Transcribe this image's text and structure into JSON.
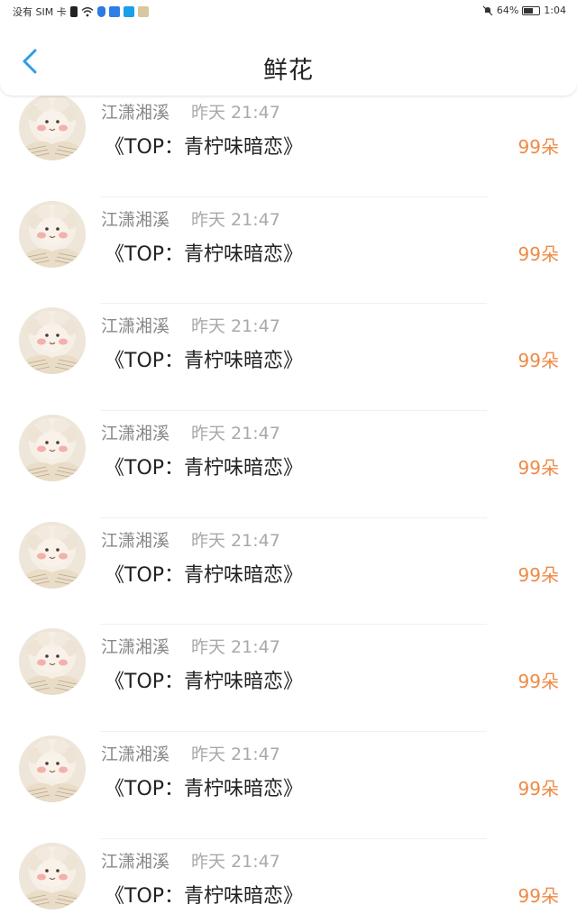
{
  "status_bar": {
    "carrier": "没有 SIM 卡",
    "battery_percent": "64%",
    "battery_level": 0.64,
    "time": "1:04"
  },
  "header": {
    "title": "鲜花",
    "back_icon": "chevron-left-icon"
  },
  "colors": {
    "accent_blue": "#2f9be8",
    "count_orange": "#ee8a45",
    "name_gray": "#888888",
    "time_gray": "#a9a9a9"
  },
  "items": [
    {
      "user": "江潇湘溪",
      "time": "昨天 21:47",
      "gift": "《TOP：青柠味暗恋》",
      "count": "99朵"
    },
    {
      "user": "江潇湘溪",
      "time": "昨天 21:47",
      "gift": "《TOP：青柠味暗恋》",
      "count": "99朵"
    },
    {
      "user": "江潇湘溪",
      "time": "昨天 21:47",
      "gift": "《TOP：青柠味暗恋》",
      "count": "99朵"
    },
    {
      "user": "江潇湘溪",
      "time": "昨天 21:47",
      "gift": "《TOP：青柠味暗恋》",
      "count": "99朵"
    },
    {
      "user": "江潇湘溪",
      "time": "昨天 21:47",
      "gift": "《TOP：青柠味暗恋》",
      "count": "99朵"
    },
    {
      "user": "江潇湘溪",
      "time": "昨天 21:47",
      "gift": "《TOP：青柠味暗恋》",
      "count": "99朵"
    },
    {
      "user": "江潇湘溪",
      "time": "昨天 21:47",
      "gift": "《TOP：青柠味暗恋》",
      "count": "99朵"
    },
    {
      "user": "江潇湘溪",
      "time": "昨天 21:47",
      "gift": "《TOP：青柠味暗恋》",
      "count": "99朵"
    }
  ]
}
